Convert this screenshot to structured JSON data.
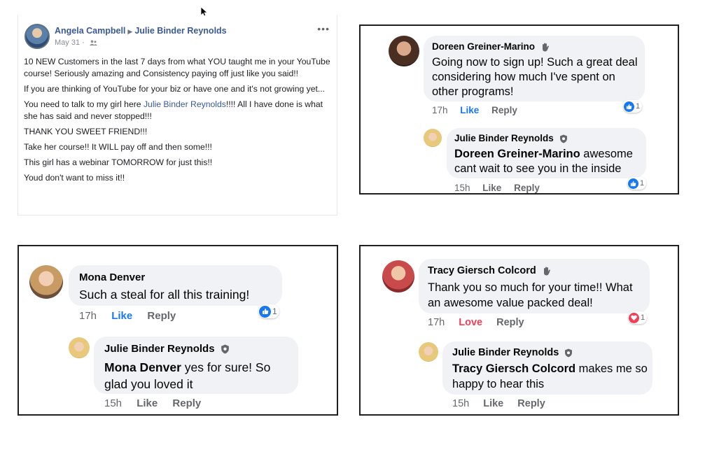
{
  "post": {
    "author": "Angela Campbell",
    "recipient": "Julie Binder Reynolds",
    "date": "May 31 ·",
    "menu": "•••",
    "p1": "10 NEW Customers in the last 7 days from what YOU taught me in your YouTube course! Seriously amazing and Consistency paying off just like you said!!",
    "p2": "If you are thinking of YouTube for your biz or have one and it's not growing yet...",
    "p3_before": "You need to talk to my girl here ",
    "p3_mention": "Julie Binder Reynolds",
    "p3_after": "!!!! All I have done is what she has said and never stopped!!!",
    "p4": "THANK YOU SWEET FRIEND!!!",
    "p5": "Take her course!! It WILL pay off and then some!!!",
    "p6": "This girl has a webinar TOMORROW for just this!!",
    "p7": "Youd don't want to miss it!!"
  },
  "panel1": {
    "comment": {
      "name": "Doreen Greiner-Marino",
      "text": "Going now to sign up! Such a great deal considering how much I've spent on other programs!",
      "time": "17h",
      "like": "Like",
      "reply": "Reply",
      "reaction_count": "1"
    },
    "reply": {
      "name": "Julie Binder Reynolds",
      "mention": "Doreen Greiner-Marino",
      "text": " awesome cant wait to see you in the inside",
      "time": "15h",
      "like": "Like",
      "reply": "Reply",
      "reaction_count": "1"
    }
  },
  "panel2": {
    "comment": {
      "name": "Mona Denver",
      "text": "Such a steal for all this training!",
      "time": "17h",
      "like": "Like",
      "reply": "Reply",
      "reaction_count": "1"
    },
    "reply": {
      "name": "Julie Binder Reynolds",
      "mention": "Mona Denver",
      "text": " yes for sure! So glad you loved it",
      "time": "15h",
      "like": "Like",
      "reply": "Reply"
    }
  },
  "panel3": {
    "comment": {
      "name": "Tracy Giersch Colcord",
      "text": "Thank you so much for your time!! What an awesome value packed deal!",
      "time": "17h",
      "love": "Love",
      "reply": "Reply",
      "reaction_count": "1"
    },
    "reply": {
      "name": "Julie Binder Reynolds",
      "mention": "Tracy Giersch Colcord",
      "text": " makes me so happy to hear this",
      "time": "15h",
      "like": "Like",
      "reply": "Reply"
    }
  },
  "colors": {
    "link": "#3b5998",
    "like_blue": "#1877f2",
    "love_red": "#f33e58",
    "bubble": "#f0f2f5"
  },
  "icons": [
    "cursor-arrow-icon",
    "friends-audience-icon",
    "wave-hand-icon",
    "shield-badge-icon",
    "thumbs-up-icon",
    "heart-icon"
  ]
}
